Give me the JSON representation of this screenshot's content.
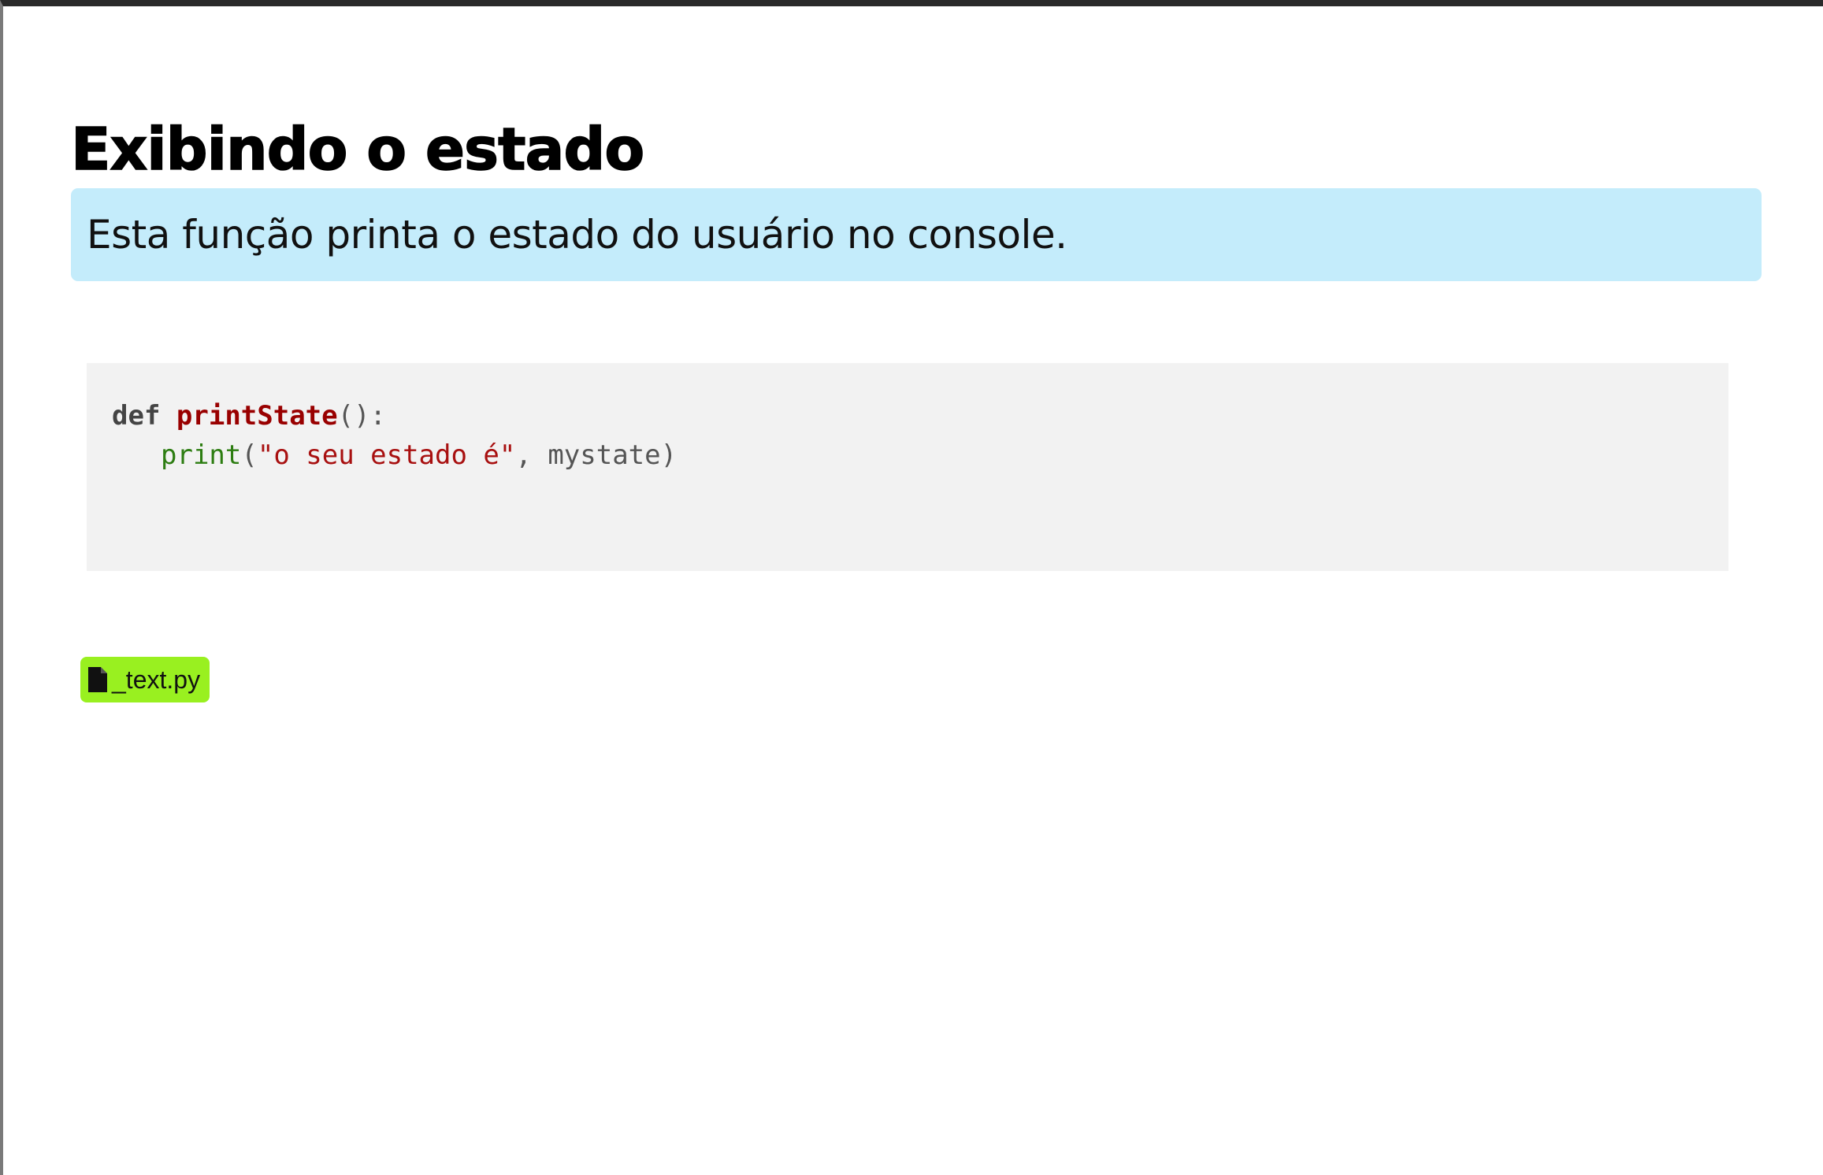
{
  "page": {
    "title": "Exibindo o estado",
    "info": "Esta função printa o estado do usuário no console."
  },
  "code": {
    "language": "python",
    "line1": {
      "keyword": "def",
      "space": " ",
      "function_name": "printState",
      "punct": "():"
    },
    "line2": {
      "builtin": "print",
      "open": "(",
      "string": "\"o seu estado é\"",
      "separator": ", ",
      "arg": "mystate",
      "close": ")"
    }
  },
  "attachment": {
    "icon": "file-icon",
    "label": "_text.py",
    "color": "#99f020"
  },
  "colors": {
    "info_background": "#c4ecfb",
    "code_background": "#f2f2f2",
    "function_name": "#990000",
    "builtin": "#2d7d12",
    "string": "#a81010"
  }
}
